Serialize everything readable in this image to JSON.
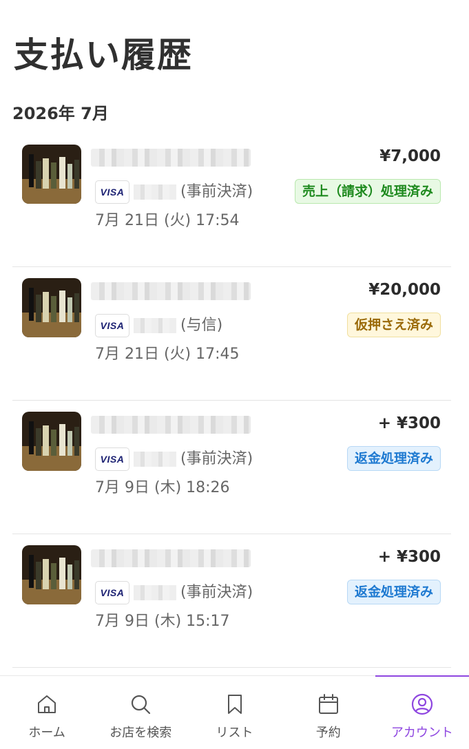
{
  "header": {
    "title": "支払い履歴"
  },
  "month": "2026年 7月",
  "payments": [
    {
      "amount": "¥7,000",
      "card_brand": "VISA",
      "method": "(事前決済)",
      "status": "売上（請求）処理済み",
      "status_type": "green",
      "datetime": "7月 21日 (火) 17:54"
    },
    {
      "amount": "¥20,000",
      "card_brand": "VISA",
      "method": "(与信)",
      "status": "仮押さえ済み",
      "status_type": "yellow",
      "datetime": "7月 21日 (火) 17:45"
    },
    {
      "amount": "+ ¥300",
      "card_brand": "VISA",
      "method": "(事前決済)",
      "status": "返金処理済み",
      "status_type": "blue",
      "datetime": "7月 9日 (木) 18:26"
    },
    {
      "amount": "+ ¥300",
      "card_brand": "VISA",
      "method": "(事前決済)",
      "status": "返金処理済み",
      "status_type": "blue",
      "datetime": "7月 9日 (木) 15:17"
    }
  ],
  "nav": {
    "items": [
      {
        "label": "ホーム",
        "icon": "home-icon"
      },
      {
        "label": "お店を検索",
        "icon": "search-icon"
      },
      {
        "label": "リスト",
        "icon": "bookmark-icon"
      },
      {
        "label": "予約",
        "icon": "calendar-icon"
      },
      {
        "label": "アカウント",
        "icon": "account-icon",
        "active": true
      }
    ],
    "active_color": "#8e46e0"
  }
}
